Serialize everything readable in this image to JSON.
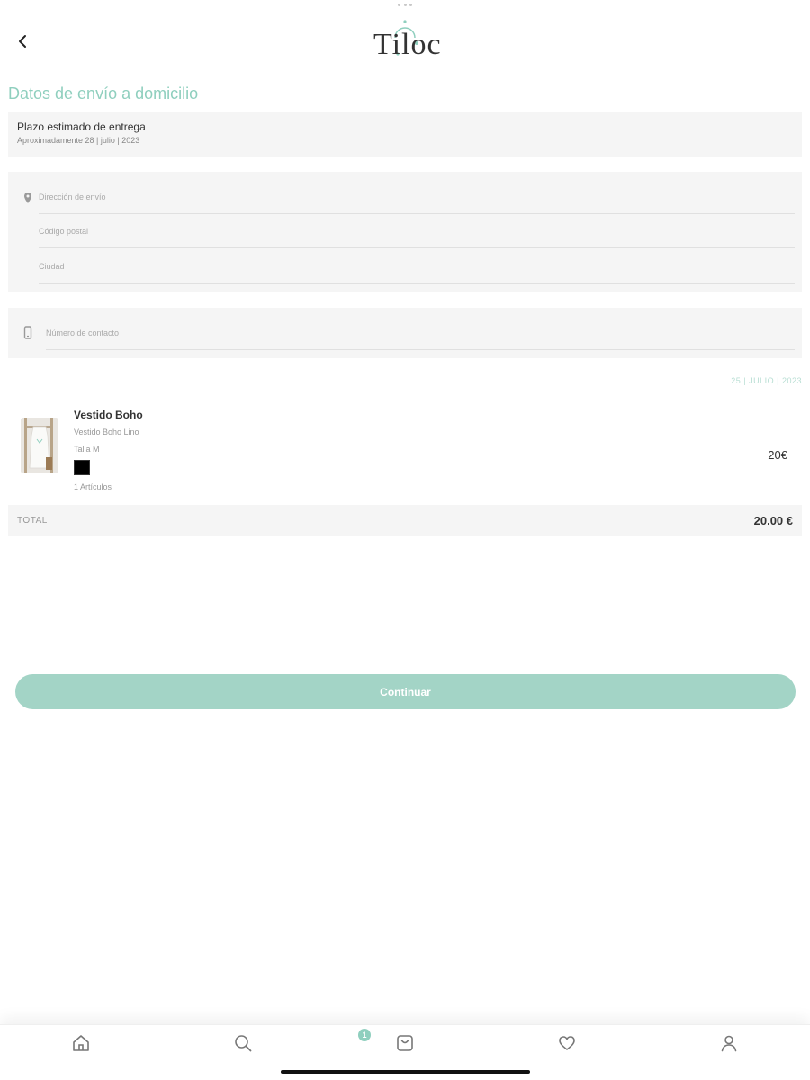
{
  "header": {
    "logo_text": "Tiloc"
  },
  "page": {
    "title": "Datos de envío a domicilio"
  },
  "delivery": {
    "label": "Plazo estimado de entrega",
    "estimate": "Aproximadamente 28 | julio | 2023"
  },
  "address_form": {
    "address_placeholder": "Dirección de envío",
    "postal_placeholder": "Código postal",
    "city_placeholder": "Ciudad"
  },
  "contact_form": {
    "phone_placeholder": "Número de contacto"
  },
  "order": {
    "date": "25 | JULIO | 2023",
    "item": {
      "name": "Vestido Boho",
      "subtitle": "Vestido Boho Lino",
      "size": "Talla M",
      "color": "#000000",
      "quantity": "1 Artículos",
      "price": "20€"
    },
    "total_label": "TOTAL",
    "total_value": "20.00 €"
  },
  "actions": {
    "continue_label": "Continuar"
  },
  "tabbar": {
    "cart_badge": "1",
    "items": [
      "home-icon",
      "search-icon",
      "bag-icon",
      "heart-icon",
      "user-icon"
    ]
  },
  "colors": {
    "accent": "#8fcfbe",
    "button": "#a3d4c6",
    "panel": "#f5f5f5"
  }
}
